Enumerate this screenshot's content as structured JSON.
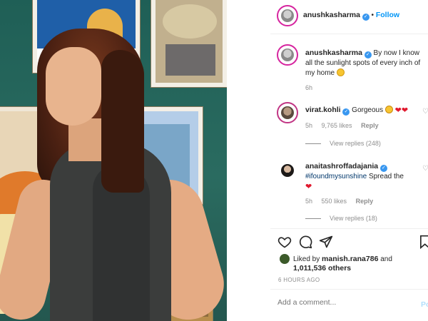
{
  "post": {
    "username": "anushkasharma",
    "follow_label": "Follow",
    "separator": "•"
  },
  "caption": {
    "username": "anushkasharma",
    "text": "By now I know all the sunlight spots of every inch of my home",
    "time": "6h"
  },
  "comments": [
    {
      "username": "virat.kohli",
      "text": "Gorgeous",
      "time": "5h",
      "likes": "9,765 likes",
      "reply_label": "Reply",
      "view_replies": "View replies (248)"
    },
    {
      "username": "anaitashroffadajania",
      "hashtag": "#ifoundmysunshine",
      "text": "Spread the",
      "time": "5h",
      "likes": "550 likes",
      "reply_label": "Reply",
      "view_replies": "View replies (18)"
    }
  ],
  "likes": {
    "prefix": "Liked by",
    "liker": "manish.rana786",
    "connector": "and",
    "others": "1,011,536 others"
  },
  "timestamp": "6 HOURS AGO",
  "add_comment": {
    "placeholder": "Add a comment...",
    "post_label": "Po"
  },
  "icons": {
    "heart": "heart-icon",
    "comment": "comment-icon",
    "share": "paper-plane-icon",
    "save": "bookmark-icon"
  },
  "colors": {
    "accent": "#0095f6",
    "verified": "#3897f0",
    "muted": "#8e8e8e",
    "hashtag": "#00376b"
  }
}
